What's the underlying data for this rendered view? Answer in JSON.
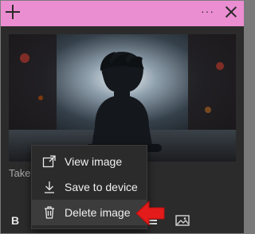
{
  "window": {
    "titlebar_color": "#eb8dd1",
    "icons": [
      "plus-icon",
      "more-options-icon",
      "close-icon"
    ],
    "more_glyph": "···"
  },
  "note": {
    "text_preview": "Take"
  },
  "context_menu": {
    "items": [
      {
        "label": "View image",
        "icon": "view-image-icon"
      },
      {
        "label": "Save to device",
        "icon": "download-icon"
      },
      {
        "label": "Delete image",
        "icon": "trash-icon",
        "highlighted": true
      }
    ]
  },
  "toolbar": {
    "bold_label": "B",
    "icons": [
      "bold-icon",
      "list-icon",
      "insert-image-icon"
    ]
  },
  "annotation": {
    "color": "#e31b1b",
    "icon": "red-arrow-left"
  }
}
